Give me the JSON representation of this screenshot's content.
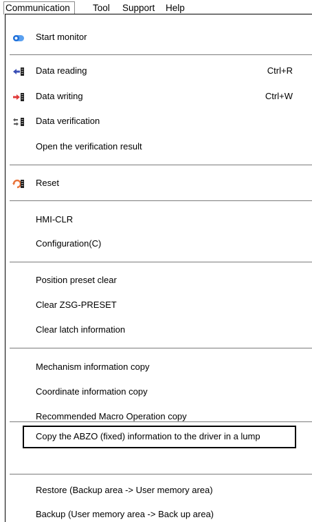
{
  "menubar": {
    "items": [
      "Communication",
      "Tool",
      "Support",
      "Help"
    ]
  },
  "menu": {
    "start_monitor": "Start monitor",
    "data_reading": "Data reading",
    "data_reading_shortcut": "Ctrl+R",
    "data_writing": "Data writing",
    "data_writing_shortcut": "Ctrl+W",
    "data_verification": "Data verification",
    "open_verification_result": "Open the verification result",
    "reset": "Reset",
    "hmi_clr": "HMI-CLR",
    "configuration": "Configuration(C)",
    "position_preset_clear": "Position preset clear",
    "clear_zsg_preset": "Clear ZSG-PRESET",
    "clear_latch_information": "Clear latch information",
    "mechanism_information_copy": "Mechanism information copy",
    "coordinate_information_copy": "Coordinate information copy",
    "recommended_macro_operation_copy": "Recommended Macro Operation copy",
    "copy_abzo": "Copy the ABZO (fixed) information to the driver in a lump",
    "restore": "Restore (Backup area -> User memory area)",
    "backup": "Backup (User memory area -> Back up area)"
  },
  "icons": {
    "start_monitor": "toggle-icon",
    "data_reading": "read-arrow-icon",
    "data_writing": "write-arrow-icon",
    "data_verification": "verify-icon",
    "reset": "reset-icon"
  },
  "colors": {
    "toggle_blue": "#1e6fd9",
    "read_arrow": "#3a4fb5",
    "write_arrow": "#e03a3a",
    "reset_orange": "#e8743b"
  }
}
